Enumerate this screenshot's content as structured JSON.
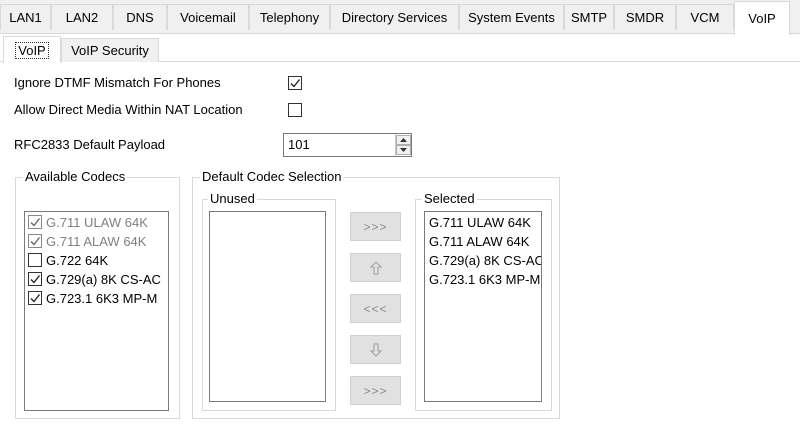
{
  "top_tabs": [
    "LAN1",
    "LAN2",
    "DNS",
    "Voicemail",
    "Telephony",
    "Directory Services",
    "System Events",
    "SMTP",
    "SMDR",
    "VCM",
    "VoIP"
  ],
  "active_top_tab": "VoIP",
  "sub_tabs": [
    "VoIP",
    "VoIP Security"
  ],
  "active_sub_tab": "VoIP",
  "options": {
    "ignore_dtmf": {
      "label": "Ignore DTMF Mismatch For Phones",
      "checked": true
    },
    "direct_media": {
      "label": "Allow Direct Media Within NAT Location",
      "checked": false
    }
  },
  "rfc2833": {
    "label": "RFC2833 Default Payload",
    "value": "101"
  },
  "available_codecs": {
    "title": "Available Codecs",
    "items": [
      {
        "label": "G.711 ULAW 64K",
        "checked": true,
        "disabled": true
      },
      {
        "label": "G.711 ALAW 64K",
        "checked": true,
        "disabled": true
      },
      {
        "label": "G.722 64K",
        "checked": false,
        "disabled": false
      },
      {
        "label": "G.729(a) 8K CS-AC",
        "checked": true,
        "disabled": false
      },
      {
        "label": "G.723.1 6K3 MP-M",
        "checked": true,
        "disabled": false
      }
    ]
  },
  "default_codec_selection": {
    "title": "Default Codec Selection",
    "unused_label": "Unused",
    "selected_label": "Selected",
    "unused_items": [],
    "selected_items": [
      "G.711 ULAW 64K",
      "G.711 ALAW 64K",
      "G.729(a) 8K CS-AC",
      "G.723.1 6K3 MP-M"
    ],
    "buttons": {
      "add": ">>>",
      "move_up": "up-arrow-icon",
      "remove": "<<<",
      "move_down": "down-arrow-icon",
      "add_all": ">>>"
    }
  }
}
